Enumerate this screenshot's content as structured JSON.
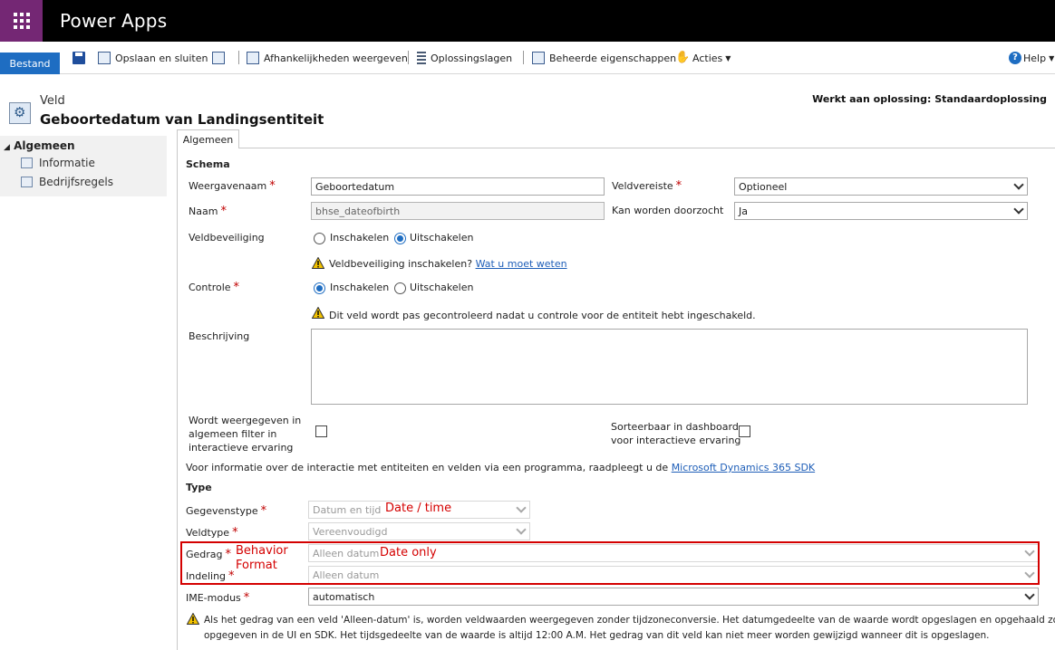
{
  "app": {
    "title": "Power Apps"
  },
  "toolbar": {
    "file_tab": "Bestand",
    "save_close": "Opslaan en sluiten",
    "dependencies": "Afhankelijkheden weergeven",
    "solution_layers": "Oplossingslagen",
    "managed_properties": "Beheerde eigenschappen",
    "actions": "Acties",
    "help": "Help"
  },
  "header": {
    "entity_type": "Veld",
    "title": "Geboortedatum van Landingsentiteit",
    "solution": "Werkt aan oplossing: Standaardoplossing"
  },
  "nav": {
    "group": "Algemeen",
    "items": [
      "Informatie",
      "Bedrijfsregels"
    ]
  },
  "tab": {
    "label": "Algemeen"
  },
  "schema": {
    "heading": "Schema",
    "display_name_label": "Weergavenaam",
    "display_name_value": "Geboortedatum",
    "name_label": "Naam",
    "name_value": "bhse_dateofbirth",
    "field_req_label": "Veldvereiste",
    "field_req_value": "Optioneel",
    "searchable_label": "Kan worden doorzocht",
    "searchable_value": "Ja",
    "security_label": "Veldbeveiliging",
    "security_enable": "Inschakelen",
    "security_disable": "Uitschakelen",
    "security_warning": "Veldbeveiliging inschakelen?",
    "security_link": "Wat u moet weten",
    "audit_label": "Controle",
    "audit_enable": "Inschakelen",
    "audit_disable": "Uitschakelen",
    "audit_warning": "Dit veld wordt pas gecontroleerd nadat u controle voor de entiteit hebt ingeschakeld.",
    "description_label": "Beschrijving",
    "filter_label_1": "Wordt weergegeven in",
    "filter_label_2": "algemeen filter in",
    "filter_label_3": "interactieve ervaring",
    "sortable_label_1": "Sorteerbaar in dashboard",
    "sortable_label_2": "voor interactieve ervaring",
    "sdk_text": "Voor informatie over de interactie met entiteiten en velden via een programma, raadpleegt u de",
    "sdk_link": "Microsoft Dynamics 365 SDK"
  },
  "type": {
    "heading": "Type",
    "data_type_label": "Gegevenstype",
    "data_type_value": "Datum en tijd",
    "field_type_label": "Veldtype",
    "field_type_value": "Vereenvoudigd",
    "behavior_label": "Gedrag",
    "behavior_value": "Alleen datum",
    "format_label": "Indeling",
    "format_value": "Alleen datum",
    "ime_label": "IME-modus",
    "ime_value": "automatisch",
    "note_line1": "Als het gedrag van een veld 'Alleen-datum' is, worden veldwaarden weergegeven zonder tijdzoneconversie. Het datumgedeelte van de waarde wordt opgeslagen en opgehaald zoals",
    "note_line2": "opgegeven in de UI en SDK. Het tijdsgedeelte van de waarde is altijd 12:00 A.M. Het gedrag van dit veld kan niet meer worden gewijzigd wanneer dit is opgeslagen."
  },
  "annotations": {
    "date_time": "Date / time",
    "behavior": "Behavior",
    "format": "Format",
    "date_only": "Date only"
  },
  "colors": {
    "accent": "#742774",
    "link": "#1e5eb8",
    "annotation": "#d40000"
  }
}
